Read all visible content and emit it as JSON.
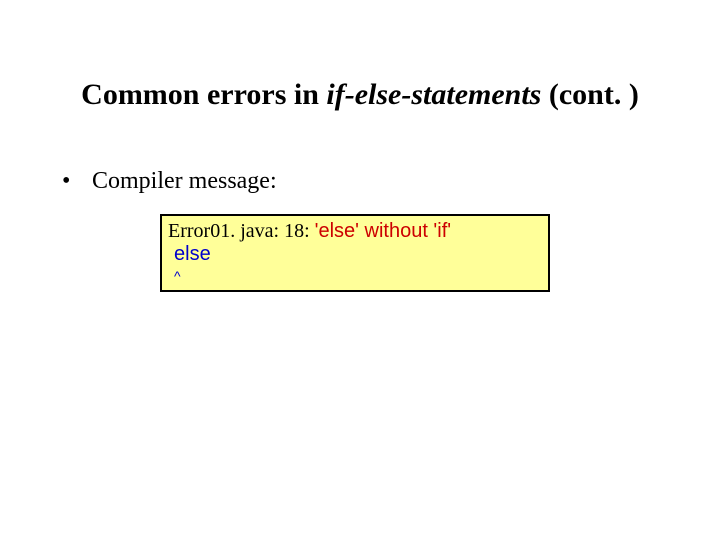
{
  "title": {
    "prefix": "Common errors in ",
    "italic": "if-else-statements",
    "suffix": " (cont. )"
  },
  "bullet": "Compiler message:",
  "error": {
    "location": "Error01. java: 18: ",
    "message": "'else' without 'if'",
    "codeline": "else",
    "caret": "^"
  }
}
